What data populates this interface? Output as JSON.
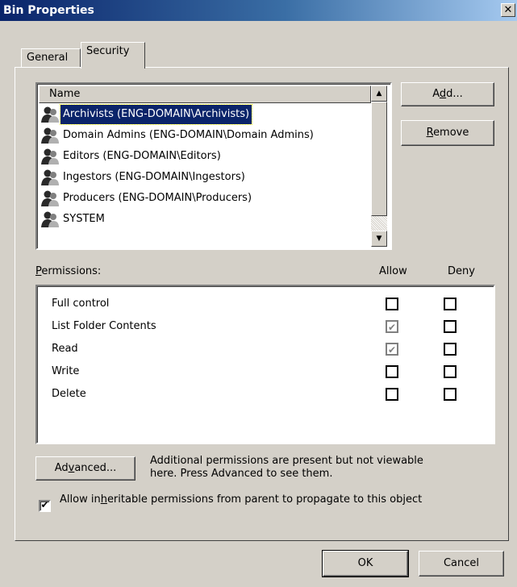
{
  "window": {
    "title": "Bin Properties",
    "close_glyph": "✕"
  },
  "tabs": [
    {
      "label": "General",
      "active": false
    },
    {
      "label": "Security",
      "active": true
    }
  ],
  "names_list": {
    "header": "Name",
    "items": [
      {
        "label": "Archivists (ENG-DOMAIN\\Archivists)",
        "icon": "group-icon",
        "selected": true
      },
      {
        "label": "Domain Admins (ENG-DOMAIN\\Domain Admins)",
        "icon": "group-icon",
        "selected": false
      },
      {
        "label": "Editors (ENG-DOMAIN\\Editors)",
        "icon": "group-icon",
        "selected": false
      },
      {
        "label": "Ingestors (ENG-DOMAIN\\Ingestors)",
        "icon": "group-icon",
        "selected": false
      },
      {
        "label": "Producers (ENG-DOMAIN\\Producers)",
        "icon": "group-icon",
        "selected": false
      },
      {
        "label": "SYSTEM",
        "icon": "group-icon",
        "selected": false
      }
    ]
  },
  "buttons": {
    "add": "Add...",
    "remove": "Remove",
    "advanced": "Advanced...",
    "ok": "OK",
    "cancel": "Cancel"
  },
  "permissions": {
    "label": "Permissions:",
    "allow_header": "Allow",
    "deny_header": "Deny",
    "rows": [
      {
        "name": "Full control",
        "allow": false,
        "deny": false
      },
      {
        "name": "List Folder Contents",
        "allow": true,
        "deny": false
      },
      {
        "name": "Read",
        "allow": true,
        "deny": false
      },
      {
        "name": "Write",
        "allow": false,
        "deny": false
      },
      {
        "name": "Delete",
        "allow": false,
        "deny": false
      }
    ]
  },
  "advanced_text": "Additional permissions are present but not viewable here. Press Advanced to see them.",
  "inherit": {
    "checked": true,
    "label": "Allow inheritable permissions from parent to propagate to this object"
  },
  "colors": {
    "dialog_bg": "#d4d0c8",
    "title_bar": "#0a246a",
    "selection": "#0a246a"
  }
}
